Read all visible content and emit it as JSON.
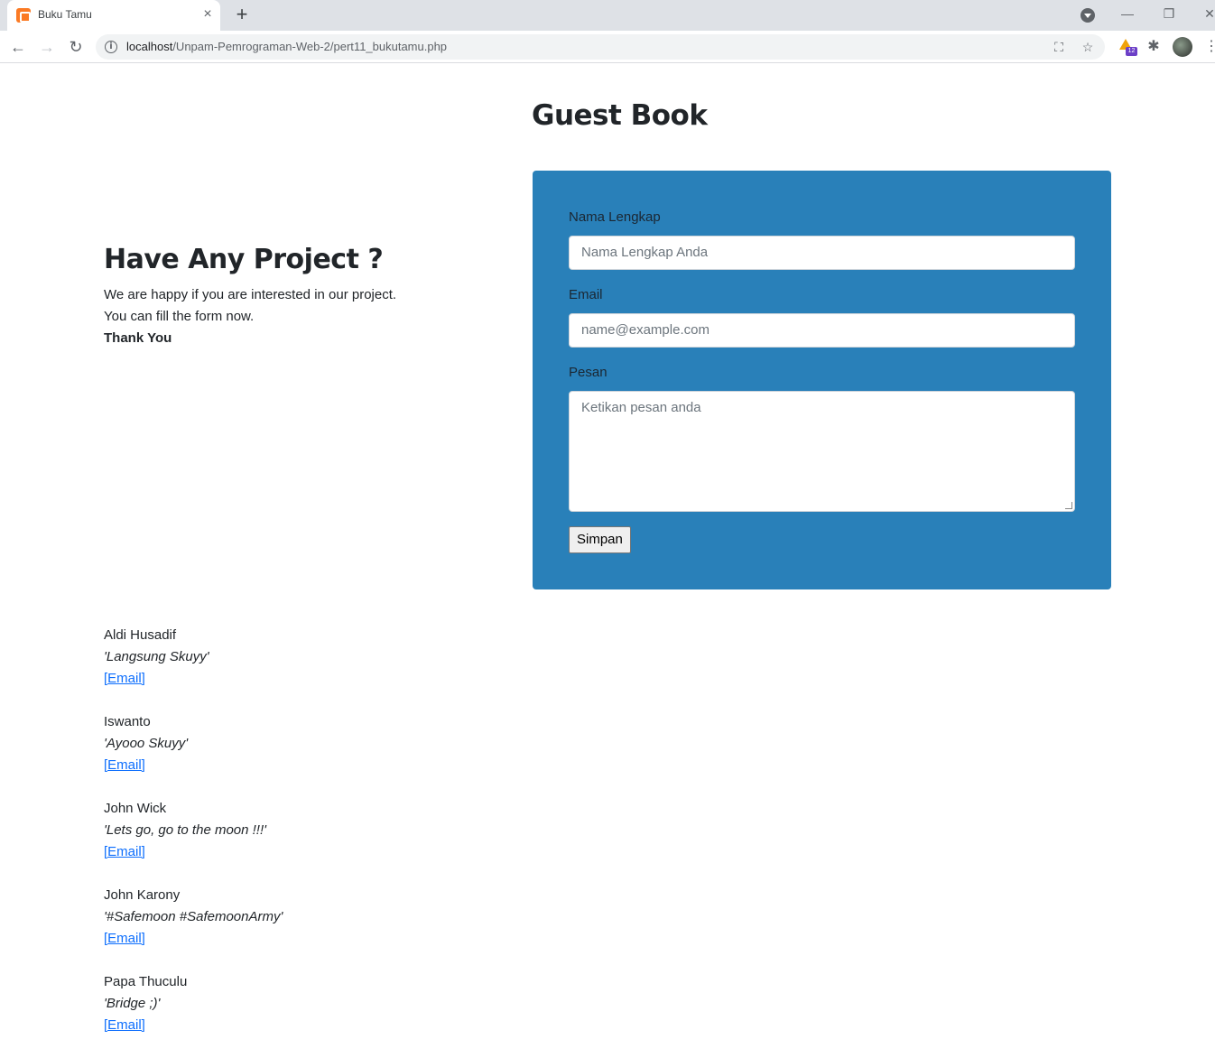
{
  "browser": {
    "tab_title": "Buku Tamu",
    "tab_close": "×",
    "new_tab": "+",
    "url_host": "localhost",
    "url_path": "/Unpam-Pemrograman-Web-2/pert11_bukutamu.php",
    "extension_badge": "12",
    "icons": {
      "back": "←",
      "forward": "→",
      "reload": "↻",
      "minimize": "—",
      "restore": "❐",
      "close": "✕",
      "translate": "⛶",
      "star": "☆",
      "puzzle": "✱",
      "menu": "⋮",
      "info": "i"
    }
  },
  "page": {
    "title": "Guest Book",
    "intro": {
      "heading": "Have Any Project ?",
      "line1": "We are happy if you are interested in our project.",
      "line2": "You can fill the form now.",
      "thanks": "Thank You"
    },
    "form": {
      "name_label": "Nama Lengkap",
      "name_placeholder": "Nama Lengkap Anda",
      "email_label": "Email",
      "email_placeholder": "name@example.com",
      "message_label": "Pesan",
      "message_placeholder": "Ketikan pesan anda",
      "submit_label": "Simpan",
      "accent_color": "#2980b9"
    },
    "entries": [
      {
        "name": "Aldi Husadif",
        "message": "'Langsung Skuyy'",
        "link": "[Email]"
      },
      {
        "name": "Iswanto",
        "message": "'Ayooo Skuyy'",
        "link": "[Email]"
      },
      {
        "name": "John Wick",
        "message": "'Lets go, go to the moon !!!'",
        "link": "[Email]"
      },
      {
        "name": "John Karony",
        "message": "'#Safemoon #SafemoonArmy'",
        "link": "[Email]"
      },
      {
        "name": "Papa Thuculu",
        "message": "'Bridge ;)'",
        "link": "[Email]"
      }
    ]
  }
}
